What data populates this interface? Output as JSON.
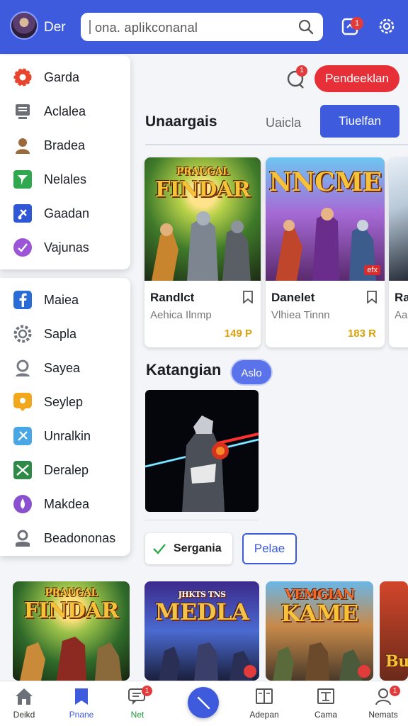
{
  "header": {
    "username": "Der",
    "search_placeholder": "ona. aplikconanal",
    "upload_badge": "1"
  },
  "menu_group_1": [
    {
      "label": "Garda",
      "icon": "gear-icon",
      "color": "#e8452f"
    },
    {
      "label": "Aclalea",
      "icon": "monitor-icon",
      "color": "#6c6f78"
    },
    {
      "label": "Bradea",
      "icon": "user-icon",
      "color": "#9a6a3b"
    },
    {
      "label": "Nelales",
      "icon": "flag-icon",
      "color": "#2fa84f"
    },
    {
      "label": "Gaadan",
      "icon": "satellite-icon",
      "color": "#2f57d6"
    },
    {
      "label": "Vajunas",
      "icon": "vote-icon",
      "color": "#9b55d6"
    }
  ],
  "menu_group_2": [
    {
      "label": "Maiea",
      "icon": "facebook-icon",
      "color": "#2a6cd6"
    },
    {
      "label": "Sapla",
      "icon": "cog-icon",
      "color": "#707480"
    },
    {
      "label": "Sayea",
      "icon": "person-icon",
      "color": "#777b85"
    },
    {
      "label": "Seylep",
      "icon": "pin-icon",
      "color": "#f2a81c"
    },
    {
      "label": "Unralkin",
      "icon": "compass-icon",
      "color": "#4aa7e6"
    },
    {
      "label": "Deralep",
      "icon": "image-icon",
      "color": "#2f8a47"
    },
    {
      "label": "Makdea",
      "icon": "drop-icon",
      "color": "#8a50d0"
    },
    {
      "label": "Beadononas",
      "icon": "person-outline-icon",
      "color": "#6c7079"
    }
  ],
  "topbar_right": {
    "notification_badge": "1",
    "cta_label": "Pendeeklan"
  },
  "section1": {
    "title": "Unaargais",
    "tab_inactive": "Uaicla",
    "tab_active": "Tiuelfan"
  },
  "cards": [
    {
      "art_top": "PRAUGAL",
      "art_bottom": "FINDAR",
      "title": "Randlct",
      "subtitle": "Aehica Ilnmp",
      "price": "149 P"
    },
    {
      "art_top": "NNCME",
      "title": "Danelet",
      "subtitle": "Vlhiea Tinnn",
      "price": "183 R",
      "corner_tag": "efx"
    },
    {
      "title": "Ra",
      "subtitle": "Aa"
    }
  ],
  "section2": {
    "title": "Katangian",
    "pill": "Aslo"
  },
  "chips": {
    "checked_label": "Sergania",
    "outlined_label": "Pelae"
  },
  "bottom_tiles": [
    {
      "art_top": "PRAUGAL",
      "art_bottom": "FINDAR"
    },
    {
      "art_top": "JHKTS TNS",
      "art_bottom": "MEDLA"
    },
    {
      "art_top": "VEMGIAN",
      "art_bottom": "KAME"
    },
    {
      "art_bottom": "Bu"
    }
  ],
  "bottom_nav": [
    {
      "label": "Deikd",
      "icon": "home-icon"
    },
    {
      "label": "Pnane",
      "icon": "bookmark-icon",
      "active": true
    },
    {
      "label": "Net",
      "icon": "chat-icon",
      "badge": "1",
      "color": "#1d9b3a"
    },
    {
      "label": "",
      "icon": "compose-icon"
    },
    {
      "label": "Adepan",
      "icon": "book-icon"
    },
    {
      "label": "Cama",
      "icon": "gallery-icon"
    },
    {
      "label": "Nemats",
      "icon": "profile-icon",
      "badge": "1"
    }
  ],
  "colors": {
    "primary": "#3d5bdc",
    "danger": "#e62f36",
    "price": "#d9a20a"
  }
}
